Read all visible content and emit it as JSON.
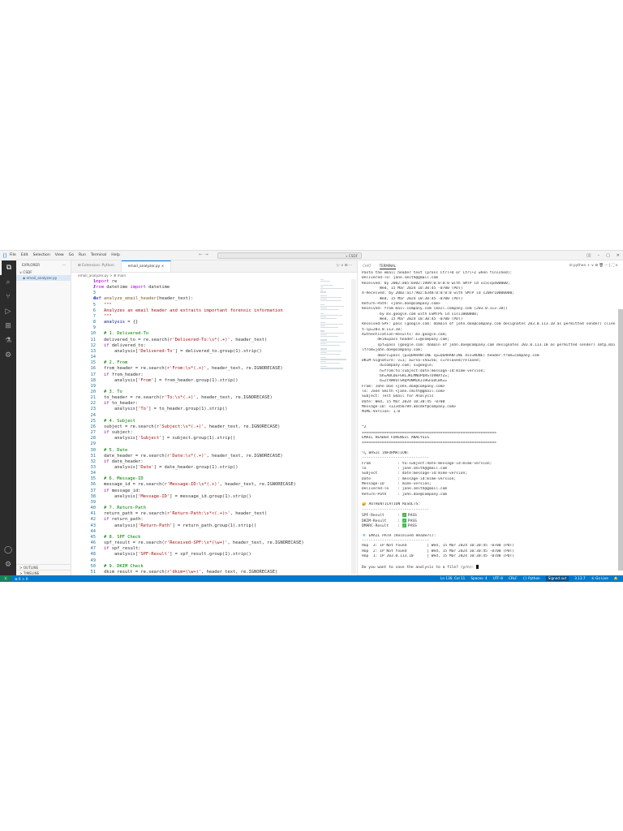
{
  "title_bar": {
    "menu": [
      "File",
      "Edit",
      "Selection",
      "View",
      "Go",
      "Run",
      "Terminal",
      "Help"
    ],
    "search": "CSDF",
    "nav": "← →"
  },
  "sidebar": {
    "header": "EXPLORER",
    "more": "···",
    "folder": "∨ CSDF",
    "file": "email_analyzer.py",
    "outline": "> OUTLINE",
    "timeline": "> TIMELINE"
  },
  "tabs": [
    {
      "label": "⊞ Extension: Python"
    },
    {
      "label": "email_analyzer.py  ×"
    }
  ],
  "editor_actions": "▷ ∨ ⊟ ···",
  "breadcrumb": "email_analyzer.py > ⊕ main",
  "code": [
    [
      [
        "kf",
        "import"
      ],
      [
        "p",
        " re"
      ]
    ],
    [
      [
        "kf",
        "from"
      ],
      [
        "p",
        " datetime "
      ],
      [
        "kf",
        "import"
      ],
      [
        "p",
        " datetime"
      ]
    ],
    [],
    [
      [
        "k",
        "def"
      ],
      [
        "p",
        " "
      ],
      [
        "f",
        "analyze_email_header"
      ],
      [
        "p",
        "(header_text):"
      ]
    ],
    [
      [
        "s",
        "    \"\"\""
      ]
    ],
    [
      [
        "s",
        "    Analyzes an email header and extracts important forensic information"
      ]
    ],
    [
      [
        "s",
        "    \"\"\""
      ]
    ],
    [
      [
        "v",
        "    analysis"
      ],
      [
        "p",
        " = {}"
      ]
    ],
    [],
    [
      [
        "c",
        "    # 1. Delivered-To"
      ]
    ],
    [
      [
        "p",
        "    delivered_to = re.search("
      ],
      [
        "s",
        "r'Delivered-To:\\s*(.+)'"
      ],
      [
        "p",
        ", header_text)"
      ]
    ],
    [
      [
        "kf",
        "    if"
      ],
      [
        "p",
        " delivered_to:"
      ]
    ],
    [
      [
        "p",
        "        analysis["
      ],
      [
        "s",
        "'Delivered-To'"
      ],
      [
        "p",
        "] = delivered_to.group(1).strip()"
      ]
    ],
    [],
    [
      [
        "c",
        "    # 2. From"
      ]
    ],
    [
      [
        "p",
        "    from_header = re.search("
      ],
      [
        "s",
        "r'From:\\s*(.+)'"
      ],
      [
        "p",
        ", header_text, re.IGNORECASE)"
      ]
    ],
    [
      [
        "kf",
        "    if"
      ],
      [
        "p",
        " from_header:"
      ]
    ],
    [
      [
        "p",
        "        analysis["
      ],
      [
        "s",
        "'From'"
      ],
      [
        "p",
        "] = from_header.group(1).strip()"
      ]
    ],
    [],
    [
      [
        "c",
        "    # 3. To"
      ]
    ],
    [
      [
        "p",
        "    to_header = re.search("
      ],
      [
        "s",
        "r'To:\\s*(.+)'"
      ],
      [
        "p",
        ", header_text, re.IGNORECASE)"
      ]
    ],
    [
      [
        "kf",
        "    if"
      ],
      [
        "p",
        " to_header:"
      ]
    ],
    [
      [
        "p",
        "        analysis["
      ],
      [
        "s",
        "'To'"
      ],
      [
        "p",
        "] = to_header.group(1).strip()"
      ]
    ],
    [],
    [
      [
        "c",
        "    # 4. Subject"
      ]
    ],
    [
      [
        "p",
        "    subject = re.search("
      ],
      [
        "s",
        "r'Subject:\\s*(.+)'"
      ],
      [
        "p",
        ", header_text, re.IGNORECASE)"
      ]
    ],
    [
      [
        "kf",
        "    if"
      ],
      [
        "p",
        " subject:"
      ]
    ],
    [
      [
        "p",
        "        analysis["
      ],
      [
        "s",
        "'Subject'"
      ],
      [
        "p",
        "] = subject.group(1).strip()"
      ]
    ],
    [],
    [
      [
        "c",
        "    # 5. Date"
      ]
    ],
    [
      [
        "p",
        "    date_header = re.search("
      ],
      [
        "s",
        "r'Date:\\s*(.+)'"
      ],
      [
        "p",
        ", header_text, re.IGNORECASE)"
      ]
    ],
    [
      [
        "kf",
        "    if"
      ],
      [
        "p",
        " date_header:"
      ]
    ],
    [
      [
        "p",
        "        analysis["
      ],
      [
        "s",
        "'Date'"
      ],
      [
        "p",
        "] = date_header.group(1).strip()"
      ]
    ],
    [],
    [
      [
        "c",
        "    # 6. Message-ID"
      ]
    ],
    [
      [
        "p",
        "    message_id = re.search("
      ],
      [
        "s",
        "r'Message-ID:\\s*(.+)'"
      ],
      [
        "p",
        ", header_text, re.IGNORECASE)"
      ]
    ],
    [
      [
        "kf",
        "    if"
      ],
      [
        "p",
        " message_id:"
      ]
    ],
    [
      [
        "p",
        "        analysis["
      ],
      [
        "s",
        "'Message-ID'"
      ],
      [
        "p",
        "] = message_id.group(1).strip()"
      ]
    ],
    [],
    [
      [
        "c",
        "    # 7. Return-Path"
      ]
    ],
    [
      [
        "p",
        "    return_path = re.search("
      ],
      [
        "s",
        "r'Return-Path:\\s*<(.+)>'"
      ],
      [
        "p",
        ", header_text)"
      ]
    ],
    [
      [
        "kf",
        "    if"
      ],
      [
        "p",
        " return_path:"
      ]
    ],
    [
      [
        "p",
        "        analysis["
      ],
      [
        "s",
        "'Return-Path'"
      ],
      [
        "p",
        "] = return_path.group(1).strip()"
      ]
    ],
    [],
    [
      [
        "c",
        "    # 8. SPF Check"
      ]
    ],
    [
      [
        "p",
        "    spf_result = re.search("
      ],
      [
        "s",
        "r'Received-SPF:\\s*(\\w+)'"
      ],
      [
        "p",
        ", header_text, re.IGNORECASE)"
      ]
    ],
    [
      [
        "kf",
        "    if"
      ],
      [
        "p",
        " spf_result:"
      ]
    ],
    [
      [
        "p",
        "        analysis["
      ],
      [
        "s",
        "'SPF-Result'"
      ],
      [
        "p",
        "] = spf_result.group(1).strip()"
      ]
    ],
    [],
    [
      [
        "c",
        "    # 9. DKIM Check"
      ]
    ],
    [
      [
        "p",
        "    dkim_result = re.search("
      ],
      [
        "s",
        "r'dkim=(\\w+)'"
      ],
      [
        "p",
        ", header_text, re.IGNORECASE)"
      ]
    ]
  ],
  "panel": {
    "tabs": [
      "CHAT",
      "TERMINAL"
    ],
    "actions": "⊡ python  + ∨  ⊟  🗑  ···  |  ⛶  ×"
  },
  "terminal": [
    {
      "t": "Paste the email header text (press Ctrl+D or Ctrl+Z when finished):"
    },
    {
      "t": "Delivered-To: jane.smith@gmail.com"
    },
    {
      "t": "Received: by 2002:a05:6e02:1989:0:0:0:0 with SMTP id x15csp400000;"
    },
    {
      "t": "        Wed, 15 Mar 2024 10:30:45 -0700 (PDT)"
    },
    {
      "t": "X-Received: by 2002:a17:902:b348:0:0:0:0 with SMTP id s20mr10000000;"
    },
    {
      "t": "        Wed, 15 Mar 2024 10:30:45 -0700 (PDT)"
    },
    {
      "t": "Return-Path: <john.doe@company.com>"
    },
    {
      "t": "Received: from mail.company.com (mail.company.com [203.0.113.10])"
    },
    {
      "t": "        by mx.google.com with ESMTPS id s1si1000000;"
    },
    {
      "t": "        Wed, 15 Mar 2024 10:30:45 -0700 (PDT)"
    },
    {
      "t": "Received-SPF: pass (google.com: domain of john.doe@company.com designates 203.0.113.10 as permitted sender) clien"
    },
    {
      "t": "t-ip=203.0.113.10;"
    },
    {
      "t": "Authentication-Results: mx.google.com;"
    },
    {
      "t": "       dkim=pass header.i=@company.com;"
    },
    {
      "t": "       spf=pass (google.com: domain of john.doe@company.com designates 203.0.113.10 as permitted sender) smtp.mai"
    },
    {
      "t": "lfrom=john.doe@company.com;"
    },
    {
      "t": "       dmarc=pass (p=QUARANTINE sp=QUARANTINE dis=NONE) header.from=company.com"
    },
    {
      "t": "DKIM-Signature: v=1; a=rsa-sha256; c=relaxed/relaxed;"
    },
    {
      "t": "        d=company.com; s=google;"
    },
    {
      "t": "        h=from:to:subject:date:message-id:mime-version;"
    },
    {
      "t": "        bh=ABCDEFGHIJKLMNOPQRSTUVWXYZ=;"
    },
    {
      "t": "        b=ZYXWVUTSRQPONMLKJIHGFEDCBA=="
    },
    {
      "t": "From: John Doe <john.doe@company.com>"
    },
    {
      "t": "To: Jane Smith <jane.smith@gmail.com>"
    },
    {
      "t": "Subject: Test Email for Analysis"
    },
    {
      "t": "Date: Wed, 15 Mar 2024 10:30:45 -0700"
    },
    {
      "t": "Message-ID: <123456789.abcdef@company.com>"
    },
    {
      "t": "MIME-Version: 1.0"
    },
    {
      "t": ""
    },
    {
      "t": ""
    },
    {
      "t": "^Z"
    },
    {
      "t": "============================================================"
    },
    {
      "t": "EMAIL HEADER FORENSIC ANALYSIS"
    },
    {
      "t": "============================================================"
    },
    {
      "t": ""
    },
    {
      "t": "🔍 BASIC INFORMATION:"
    },
    {
      "t": "------------------------------"
    },
    {
      "t": "From            : to:subject:date:message-id:mime-version;"
    },
    {
      "t": "To              : jane.smith@gmail.com"
    },
    {
      "t": "Subject         : date:message-id:mime-version;"
    },
    {
      "t": "Date            : message-id:mime-version;"
    },
    {
      "t": "Message-ID      : mime-version;"
    },
    {
      "t": "Delivered-To    : jane.smith@gmail.com"
    },
    {
      "t": "Return-Path     : john.doe@company.com"
    },
    {
      "t": ""
    },
    {
      "t": "🔐 AUTHENTICATION RESULTS:"
    },
    {
      "t": "------------------------------"
    },
    {
      "t": "SPF-Result      : ",
      "check": "PASS"
    },
    {
      "t": "DKIM-Result     : ",
      "check": "PASS"
    },
    {
      "t": "DMARC-Result    : ",
      "check": "PASS"
    },
    {
      "t": ""
    },
    {
      "t": "📧 EMAIL PATH (Received Headers):"
    },
    {
      "t": "------------------------------"
    },
    {
      "t": "Hop  3: IP Not found         | Wed, 15 Mar 2024 10:30:45 -0700 (PDT)"
    },
    {
      "t": "Hop  2: IP Not found         | Wed, 15 Mar 2024 10:30:45 -0700 (PDT)"
    },
    {
      "t": "Hop  1: IP 203.0.113.10      | Wed, 15 Mar 2024 10:30:45 -0700 (PDT)"
    },
    {
      "t": ""
    },
    {
      "t": "Do you want to save the analysis to a file? (y/n): ",
      "cursor": true
    }
  ],
  "status": {
    "remote": "⟩⟨",
    "problems": "⊗ 0 ⚠ 0",
    "items": [
      "Ln 136, Col 11",
      "Spaces: 4",
      "UTF-8",
      "CRLF",
      "{} Python",
      "Signed out",
      "3.13.7",
      "⦿ Go Live",
      "🔔"
    ]
  },
  "colors": {
    "accent": "#007acc",
    "remote": "#16825d"
  }
}
